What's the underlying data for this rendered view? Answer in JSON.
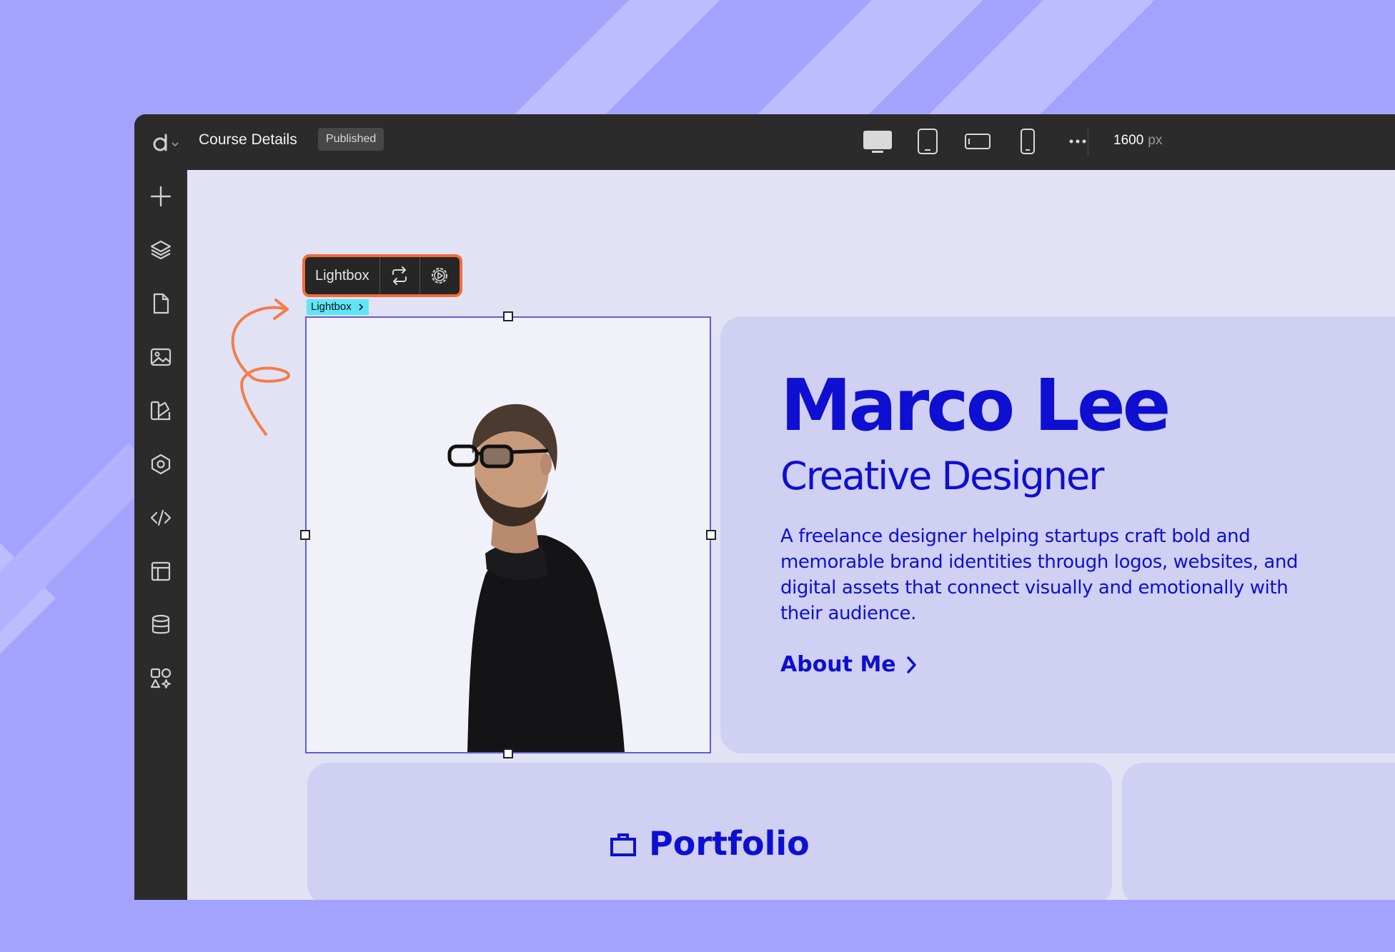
{
  "colors": {
    "background": "#a3a3fe",
    "stripe": "#bdbcff",
    "app_chrome": "#2b2b2b",
    "canvas": "#e2e2f5",
    "accent_orange": "#f26b3a",
    "brand_blue": "#0e0fd0",
    "selection": "#5f5de0",
    "breadcrumb": "#5ee6f5"
  },
  "topbar": {
    "title": "Course Details",
    "status_badge": "Published",
    "devices": [
      "desktop-icon",
      "tablet-icon",
      "tablet-landscape-icon",
      "mobile-icon",
      "more-icon"
    ],
    "width_value": "1600",
    "width_unit": "px"
  },
  "sidebar": {
    "items": [
      "add-icon",
      "layers-icon",
      "pages-icon",
      "media-icon",
      "styles-icon",
      "components-icon",
      "code-icon",
      "layout-icon",
      "database-icon",
      "apps-icon"
    ]
  },
  "toolbar": {
    "label": "Lightbox",
    "buttons": [
      "swap-icon",
      "settings-icon"
    ]
  },
  "breadcrumb": {
    "label": "Lightbox"
  },
  "hero": {
    "name": "Marco Lee",
    "role": "Creative Designer",
    "description": "A freelance designer helping startups craft bold and memorable brand identities through logos, websites, and digital assets that connect visually and emotionally with their audience.",
    "link_label": "About Me"
  },
  "section_peek": {
    "label": "Portfolio"
  }
}
